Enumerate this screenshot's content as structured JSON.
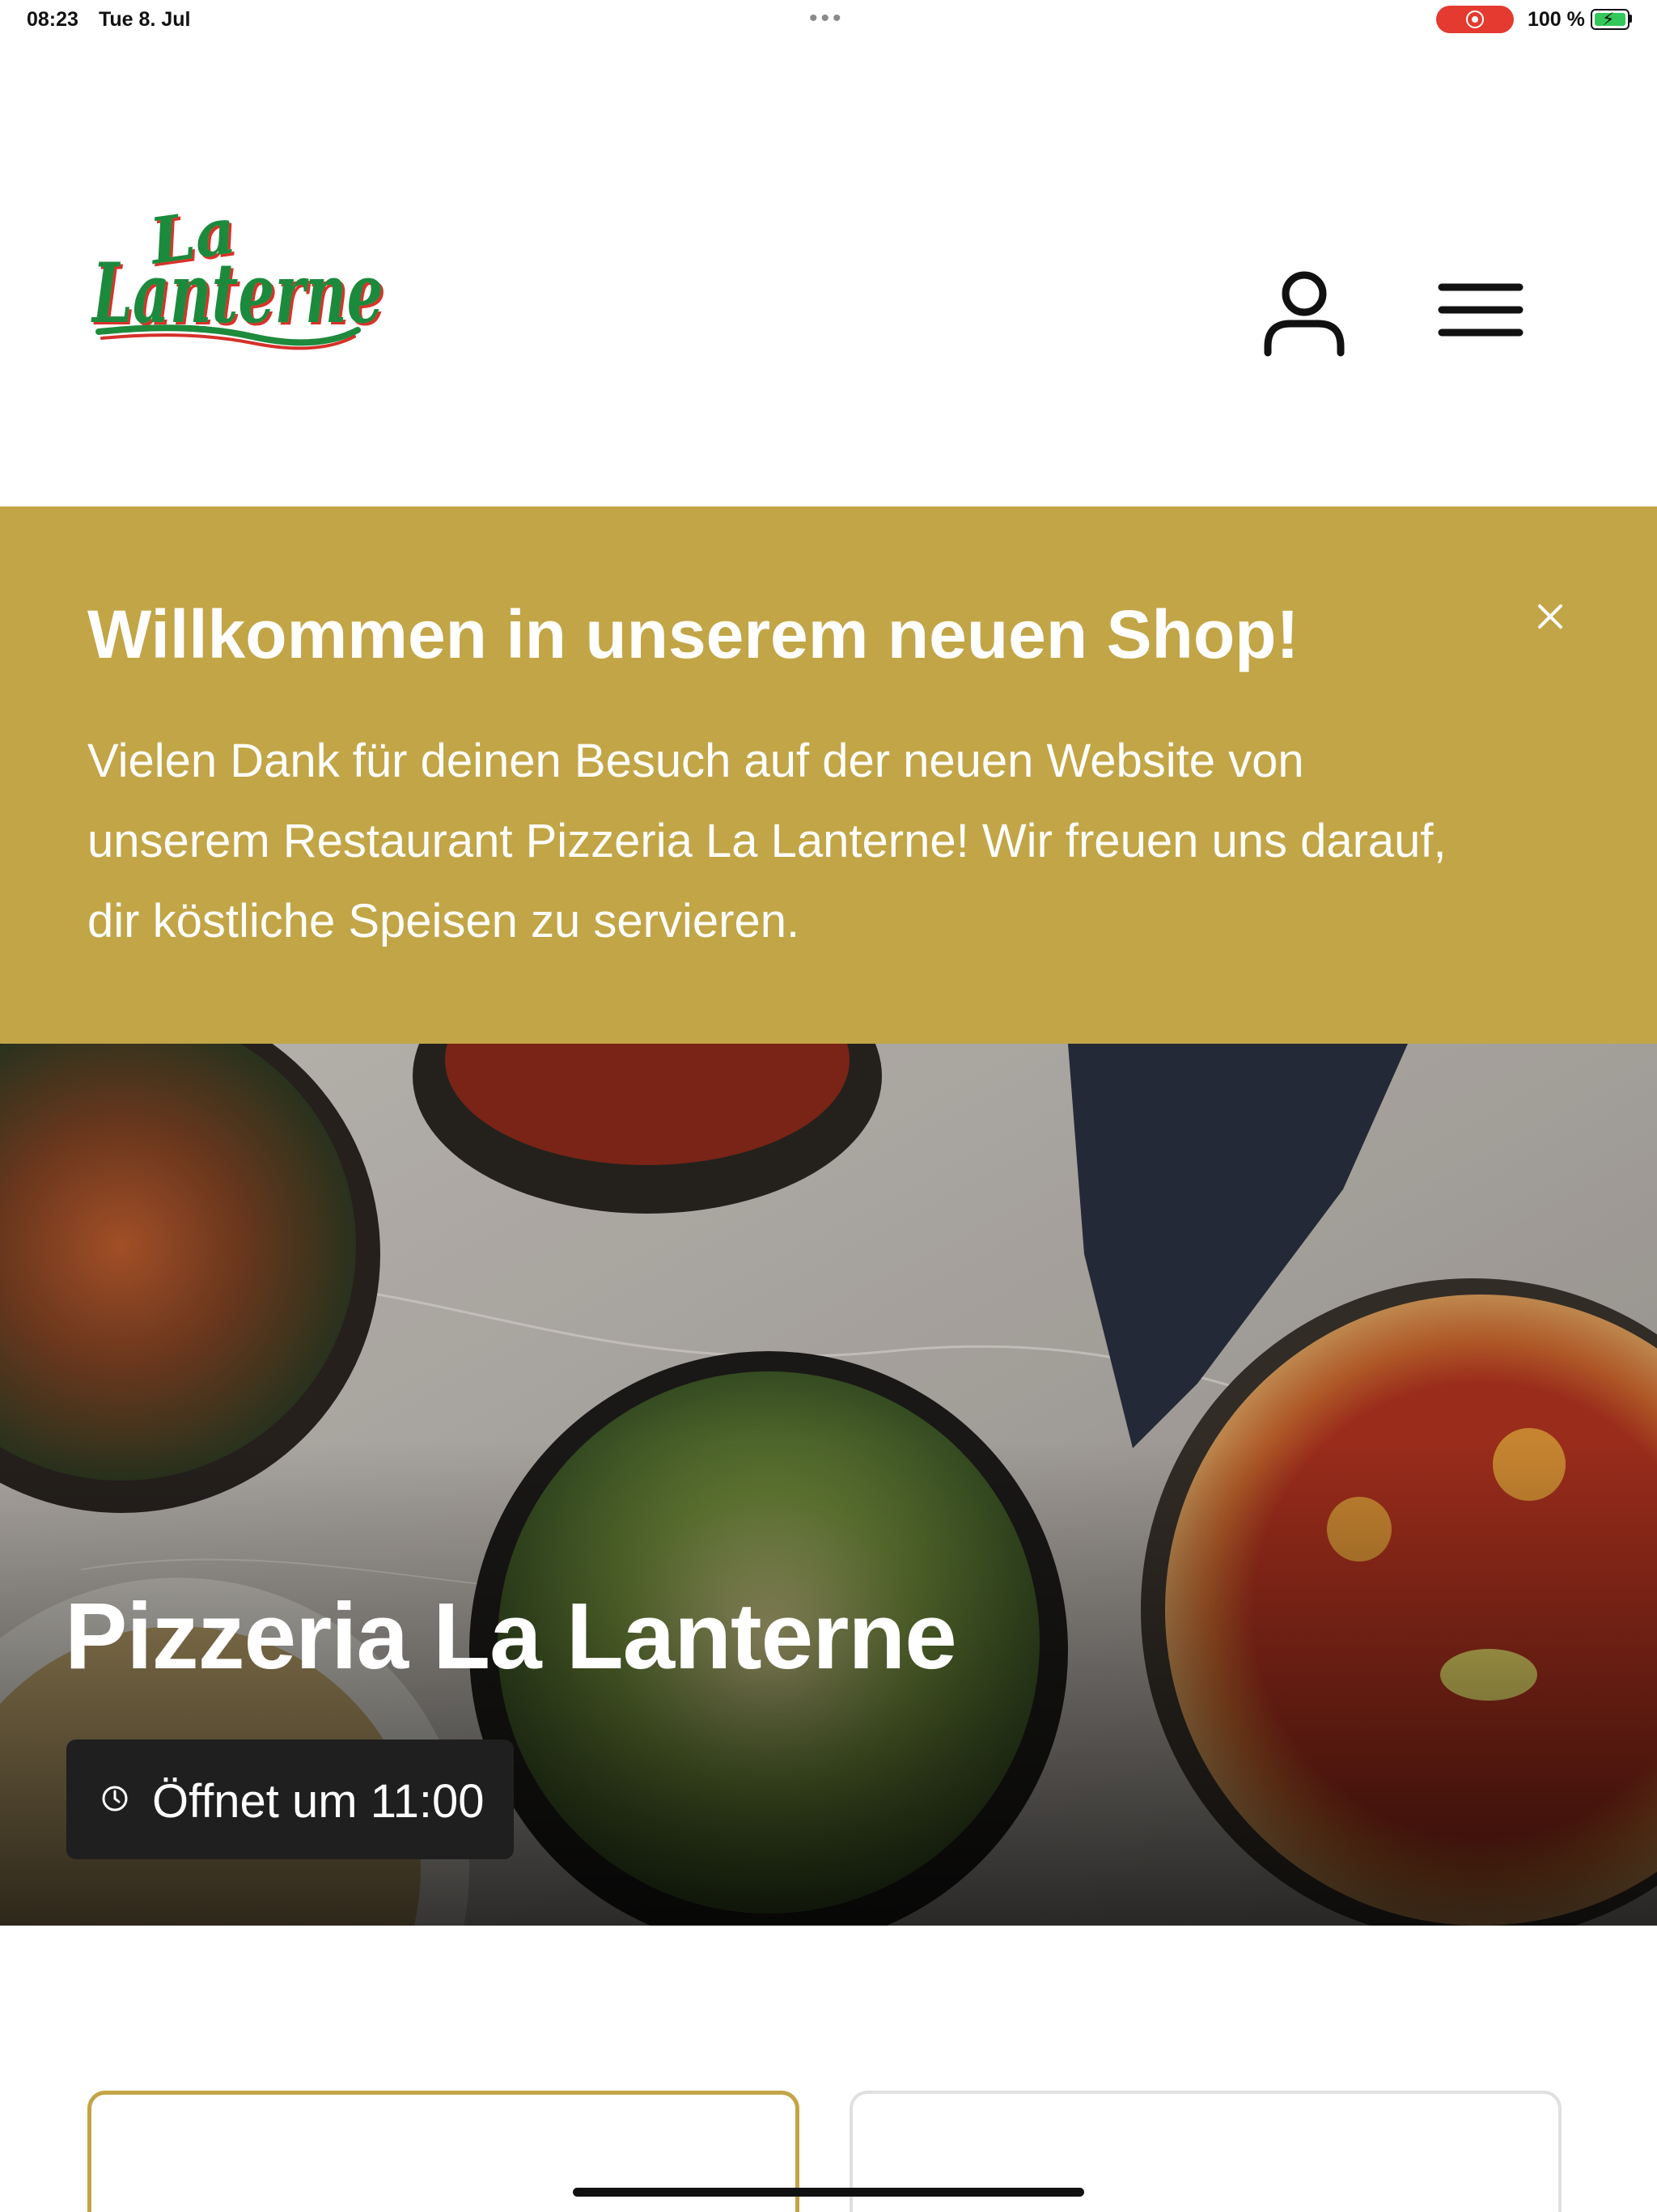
{
  "status_bar": {
    "time": "08:23",
    "date": "Tue 8. Jul",
    "multitask_dots": "•••",
    "recording_indicator_color": "#e43a2f",
    "battery_percent": "100 %"
  },
  "header": {
    "logo_name": "La Lanterne",
    "logo_colors": {
      "green": "#1e8a3c",
      "red": "#d6312b"
    },
    "user_icon": "user-icon",
    "menu_icon": "menu-icon"
  },
  "welcome_banner": {
    "title": "Willkommen in unserem neuen Shop!",
    "line1": "Vielen Dank für deinen Besuch auf der neuen Website von",
    "line2": "unserem Restaurant Pizzeria La Lanterne! Wir freuen uns darauf,",
    "line3": "dir köstliche Speisen zu servieren.",
    "close_icon": "close-icon",
    "background_color": "#c2a546"
  },
  "hero": {
    "title": "Pizzeria La Lanterne",
    "hours_label": "Öffnet um 11:00",
    "hours_icon": "clock-icon"
  },
  "cards": {
    "left_border_color": "#c2a546",
    "right_border_color": "#e0e0e0"
  }
}
